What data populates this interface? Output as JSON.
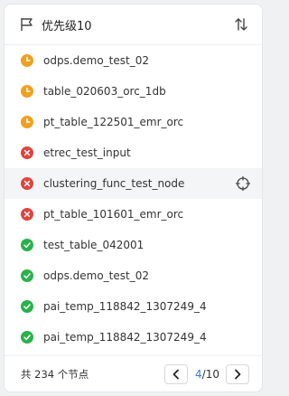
{
  "header": {
    "title": "优先级10",
    "flag_icon": "flag-icon",
    "sort_icon": "sort-arrows-icon"
  },
  "colors": {
    "waiting": "#f0a020",
    "failed": "#e0443e",
    "success": "#27b24a",
    "accent": "#3a78f2"
  },
  "items": [
    {
      "label": "odps.demo_test_02",
      "status": "waiting"
    },
    {
      "label": "table_020603_orc_1db",
      "status": "waiting"
    },
    {
      "label": "pt_table_122501_emr_orc",
      "status": "waiting"
    },
    {
      "label": "etrec_test_input",
      "status": "failed"
    },
    {
      "label": "clustering_func_test_node",
      "status": "failed",
      "active": true
    },
    {
      "label": "pt_table_101601_emr_orc",
      "status": "failed"
    },
    {
      "label": "test_table_042001",
      "status": "success"
    },
    {
      "label": "odps.demo_test_02",
      "status": "success"
    },
    {
      "label": "pai_temp_118842_1307249_4",
      "status": "success"
    },
    {
      "label": "pai_temp_118842_1307249_4",
      "status": "success"
    }
  ],
  "footer": {
    "total": "共 234 个节点",
    "current_page": "4",
    "page_sep": "/",
    "total_pages": "10"
  }
}
